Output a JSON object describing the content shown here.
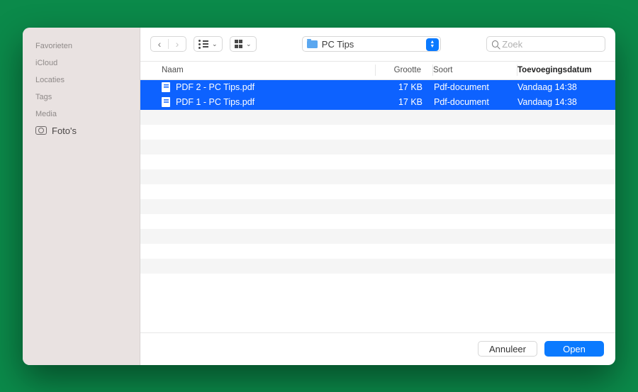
{
  "sidebar": {
    "sections": [
      {
        "label": "Favorieten"
      },
      {
        "label": "iCloud"
      },
      {
        "label": "Locaties"
      },
      {
        "label": "Tags"
      },
      {
        "label": "Media"
      }
    ],
    "media_item": "Foto's"
  },
  "toolbar": {
    "folder_name": "PC Tips",
    "search_placeholder": "Zoek"
  },
  "columns": {
    "name": "Naam",
    "size": "Grootte",
    "kind": "Soort",
    "added": "Toevoegingsdatum"
  },
  "files": [
    {
      "name": "PDF 2 - PC Tips.pdf",
      "size": "17 KB",
      "kind": "Pdf-document",
      "added": "Vandaag 14:38"
    },
    {
      "name": "PDF 1 - PC Tips.pdf",
      "size": "17 KB",
      "kind": "Pdf-document",
      "added": "Vandaag 14:38"
    }
  ],
  "footer": {
    "cancel": "Annuleer",
    "open": "Open"
  }
}
